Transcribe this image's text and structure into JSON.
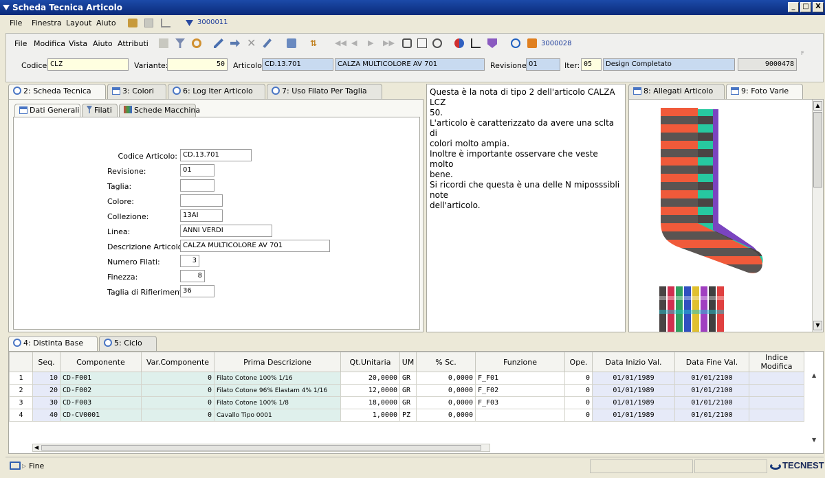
{
  "window": {
    "title": "Scheda Tecnica Articolo",
    "btn_min": "_",
    "btn_max": "□",
    "btn_close": "X"
  },
  "menubar": {
    "file": "File",
    "finestra": "Finestra",
    "layout": "Layout",
    "aiuto": "Aiuto",
    "code": "3000011"
  },
  "submenu": {
    "file": "File",
    "modifica": "Modifica",
    "vista": "Vista",
    "aiuto": "Aiuto",
    "attributi": "Attributi",
    "code": "3000028",
    "corner": "F"
  },
  "header": {
    "codice_label": "Codice:",
    "codice": "CLZ",
    "variante_label": "Variante:",
    "variante": "50",
    "articolo_label": "Articolo:",
    "articolo_code": "CD.13.701",
    "articolo_desc": "CALZA MULTICOLORE AV 701",
    "revisione_label": "Revisione:",
    "revisione": "01",
    "iter_label": "Iter:",
    "iter": "05",
    "iter_desc": "Design Completato",
    "number": "9000478"
  },
  "tabs_left": [
    "2: Scheda Tecnica",
    "3: Colori",
    "6: Log Iter Articolo",
    "7: Uso Filato Per Taglia"
  ],
  "subtabs": [
    "Dati Generali",
    "Filati",
    "Schede Macchina"
  ],
  "form": {
    "codice_articolo_label": "Codice Articolo:",
    "codice_articolo": "CD.13.701",
    "revisione_label": "Revisione:",
    "revisione": "01",
    "taglia_label": "Taglia:",
    "taglia": "",
    "colore_label": "Colore:",
    "colore": "",
    "collezione_label": "Collezione:",
    "collezione": "13AI",
    "linea_label": "Linea:",
    "linea": "ANNI VERDI",
    "descrizione_label": "Descrizione Articolo:",
    "descrizione": "CALZA MULTICOLORE AV 701",
    "numero_filati_label": "Numero Filati:",
    "numero_filati": "3",
    "finezza_label": "Finezza:",
    "finezza": "8",
    "taglia_rif_label": "Taglia di Rifierimento:",
    "taglia_rif": "36"
  },
  "note": {
    "line1": "Questa è la nota di tipo 2 dell'articolo CALZA LCZ",
    "line2": "50.",
    "line3": "L'articolo è caratterizzato da avere una sclta di",
    "line4": "colori molto ampia.",
    "line5": "Inoltre è importante osservare che veste molto",
    "line6": "bene.",
    "line7": "Si ricordi che questa è una delle N miposssibli note",
    "line8": "dell'articolo."
  },
  "tabs_right": [
    "8: Allegati Articolo",
    "9: Foto Varie"
  ],
  "tabs_bottom": [
    "4: Distinta Base",
    "5: Ciclo"
  ],
  "grid": {
    "headers": [
      "Seq.",
      "Componente",
      "Var.Componente",
      "Prima Descrizione",
      "Qt.Unitaria",
      "UM",
      "% Sc.",
      "Funzione",
      "Ope.",
      "Data Inizio Val.",
      "Data Fine Val.",
      "Indice Modifica"
    ],
    "rows": [
      {
        "n": "1",
        "seq": "10",
        "comp": "CD-F001",
        "var": "0",
        "desc": "Filato Cotone 100% 1/16",
        "qt": "20,0000",
        "um": "GR",
        "sc": "0,0000",
        "fun": "F_F01",
        "ope": "0",
        "di": "01/01/1989",
        "df": "01/01/2100",
        "idx": ""
      },
      {
        "n": "2",
        "seq": "20",
        "comp": "CD-F002",
        "var": "0",
        "desc": "Filato Cotone 96% Elastam 4% 1/16",
        "qt": "12,0000",
        "um": "GR",
        "sc": "0,0000",
        "fun": "F_F02",
        "ope": "0",
        "di": "01/01/1989",
        "df": "01/01/2100",
        "idx": ""
      },
      {
        "n": "3",
        "seq": "30",
        "comp": "CD-F003",
        "var": "0",
        "desc": "Filato Cotone 100% 1/8",
        "qt": "18,0000",
        "um": "GR",
        "sc": "0,0000",
        "fun": "F_F03",
        "ope": "0",
        "di": "01/01/1989",
        "df": "01/01/2100",
        "idx": ""
      },
      {
        "n": "4",
        "seq": "40",
        "comp": "CD-CV0001",
        "var": "0",
        "desc": "Cavallo Tipo 0001",
        "qt": "1,0000",
        "um": "PZ",
        "sc": "0,0000",
        "fun": "",
        "ope": "0",
        "di": "01/01/1989",
        "df": "01/01/2100",
        "idx": ""
      }
    ]
  },
  "status": {
    "text": "Fine",
    "brand": "TECNEST"
  },
  "icons": [
    "windows-logo-icon",
    "filter-icon",
    "pencil-icon",
    "delete-icon",
    "print-icon",
    "nav-first-icon",
    "nav-prev-icon",
    "nav-next-icon",
    "nav-last-icon",
    "search-icon",
    "question-icon",
    "grid-icon",
    "sock-image"
  ]
}
